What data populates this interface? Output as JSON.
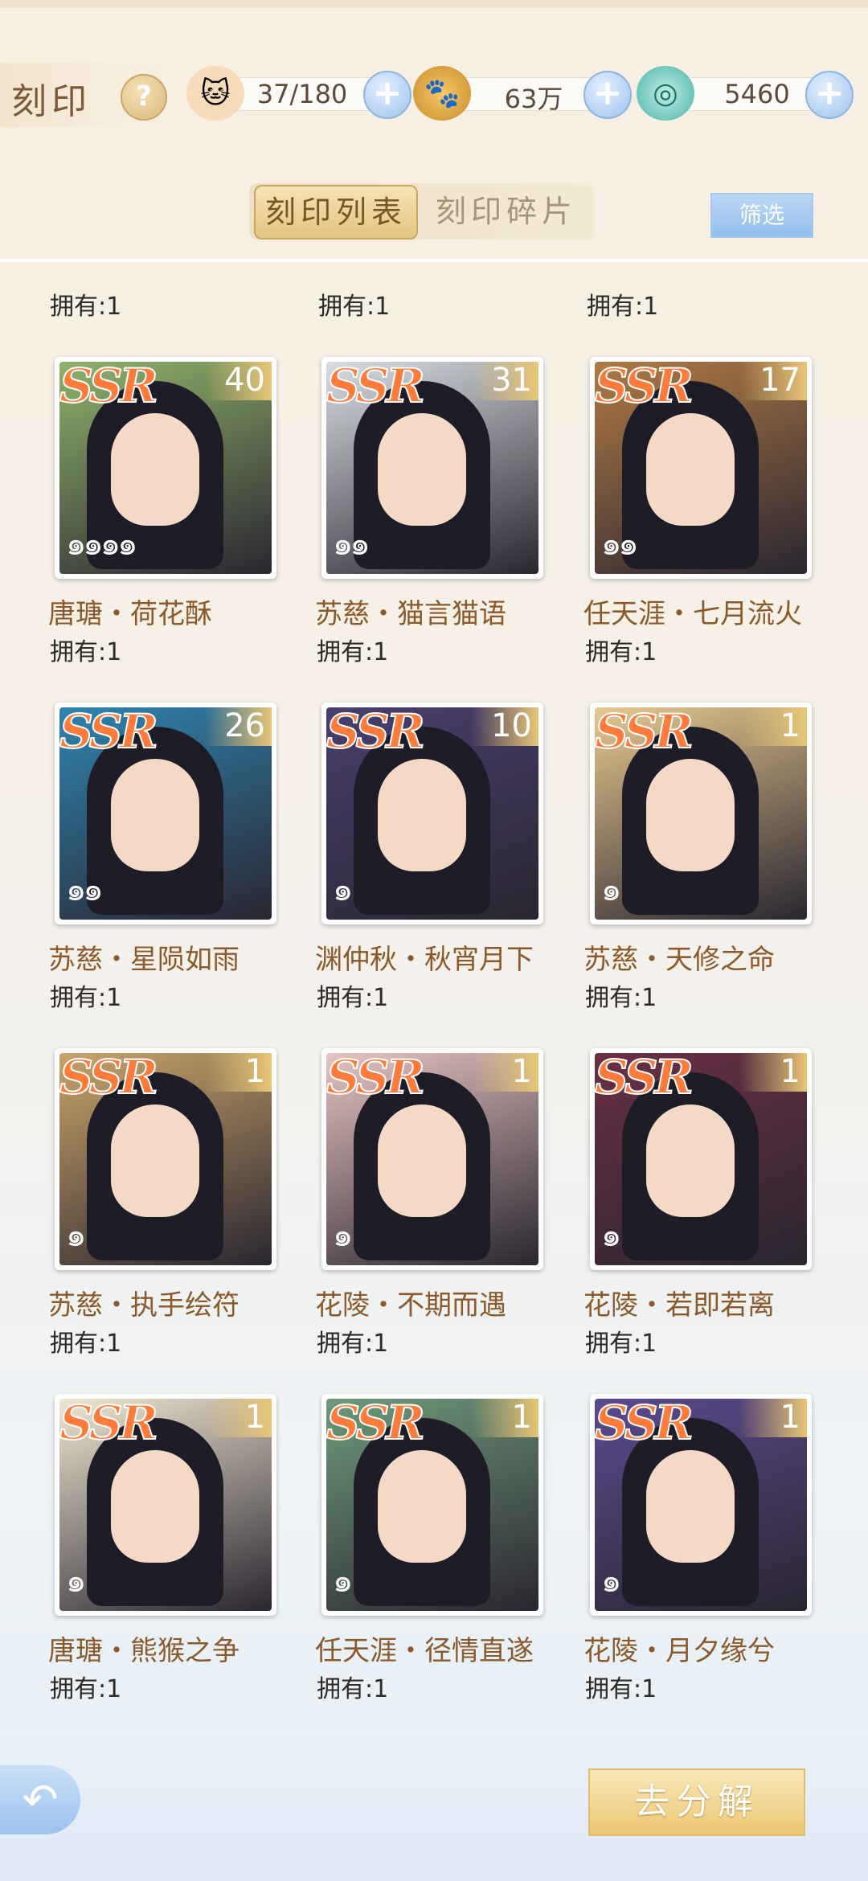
{
  "header": {
    "title": "刻印",
    "help": "?",
    "resources": [
      {
        "name": "cat-stamina-icon",
        "value": "37/180"
      },
      {
        "name": "gold-coin-icon",
        "value": "63万"
      },
      {
        "name": "jade-dragon-icon",
        "value": "5460"
      }
    ]
  },
  "tabs": [
    {
      "label": "刻印列表",
      "active": true
    },
    {
      "label": "刻印碎片",
      "active": false
    }
  ],
  "filter_label": "筛选",
  "owned_label": "拥有:1",
  "top_owned": [
    "拥有:1",
    "拥有:1",
    "拥有:1"
  ],
  "cards": [
    {
      "rarity": "SSR",
      "count": "40",
      "stars": 4,
      "name": "唐瑭・荷花酥",
      "owned": "拥有:1",
      "bg": "#8fb36b"
    },
    {
      "rarity": "SSR",
      "count": "31",
      "stars": 2,
      "name": "苏慈・猫言猫语",
      "owned": "拥有:1",
      "bg": "#d8dde2"
    },
    {
      "rarity": "SSR",
      "count": "17",
      "stars": 2,
      "name": "任天涯・七月流火",
      "owned": "拥有:1",
      "bg": "#b07a45"
    },
    {
      "rarity": "SSR",
      "count": "26",
      "stars": 2,
      "name": "苏慈・星陨如雨",
      "owned": "拥有:1",
      "bg": "#2f84b0"
    },
    {
      "rarity": "SSR",
      "count": "10",
      "stars": 1,
      "name": "渊仲秋・秋宵月下",
      "owned": "拥有:1",
      "bg": "#4a3f6e"
    },
    {
      "rarity": "SSR",
      "count": "1",
      "stars": 1,
      "name": "苏慈・天修之命",
      "owned": "拥有:1",
      "bg": "#e7c98f"
    },
    {
      "rarity": "SSR",
      "count": "1",
      "stars": 1,
      "name": "苏慈・执手绘符",
      "owned": "拥有:1",
      "bg": "#c9a46a"
    },
    {
      "rarity": "SSR",
      "count": "1",
      "stars": 1,
      "name": "花陵・不期而遇",
      "owned": "拥有:1",
      "bg": "#e6c4c0"
    },
    {
      "rarity": "SSR",
      "count": "1",
      "stars": 1,
      "name": "花陵・若即若离",
      "owned": "拥有:1",
      "bg": "#6a2f45"
    },
    {
      "rarity": "SSR",
      "count": "1",
      "stars": 1,
      "name": "唐瑭・熊猴之争",
      "owned": "拥有:1",
      "bg": "#f1e6d2"
    },
    {
      "rarity": "SSR",
      "count": "1",
      "stars": 1,
      "name": "任天涯・径情直遂",
      "owned": "拥有:1",
      "bg": "#6f9a7a"
    },
    {
      "rarity": "SSR",
      "count": "1",
      "stars": 1,
      "name": "花陵・月夕缘兮",
      "owned": "拥有:1",
      "bg": "#5c4a8e"
    }
  ],
  "bottom": {
    "back_icon": "back-arrow-icon",
    "decompose_label": "去分解"
  }
}
